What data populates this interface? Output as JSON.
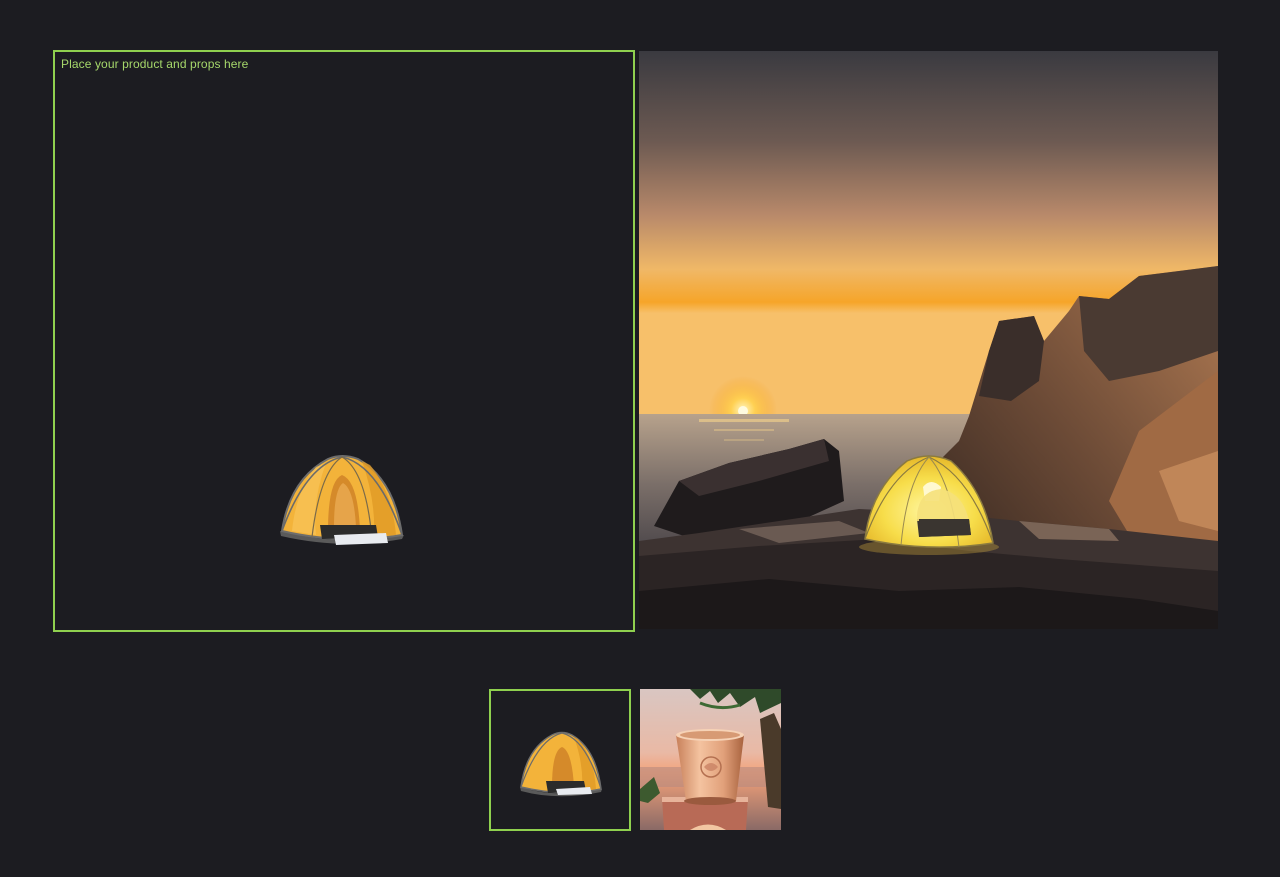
{
  "editor": {
    "hint": "Place your product and props here",
    "accent_color": "#8fd04f"
  },
  "canvas_product": {
    "icon": "tent-icon"
  },
  "result_image": {
    "subject": "tent-icon",
    "scene": "sunset-coast-rocks"
  },
  "thumbnails": [
    {
      "icon": "tent-icon",
      "selected": true
    },
    {
      "icon": "copper-cup-icon",
      "selected": false
    }
  ]
}
